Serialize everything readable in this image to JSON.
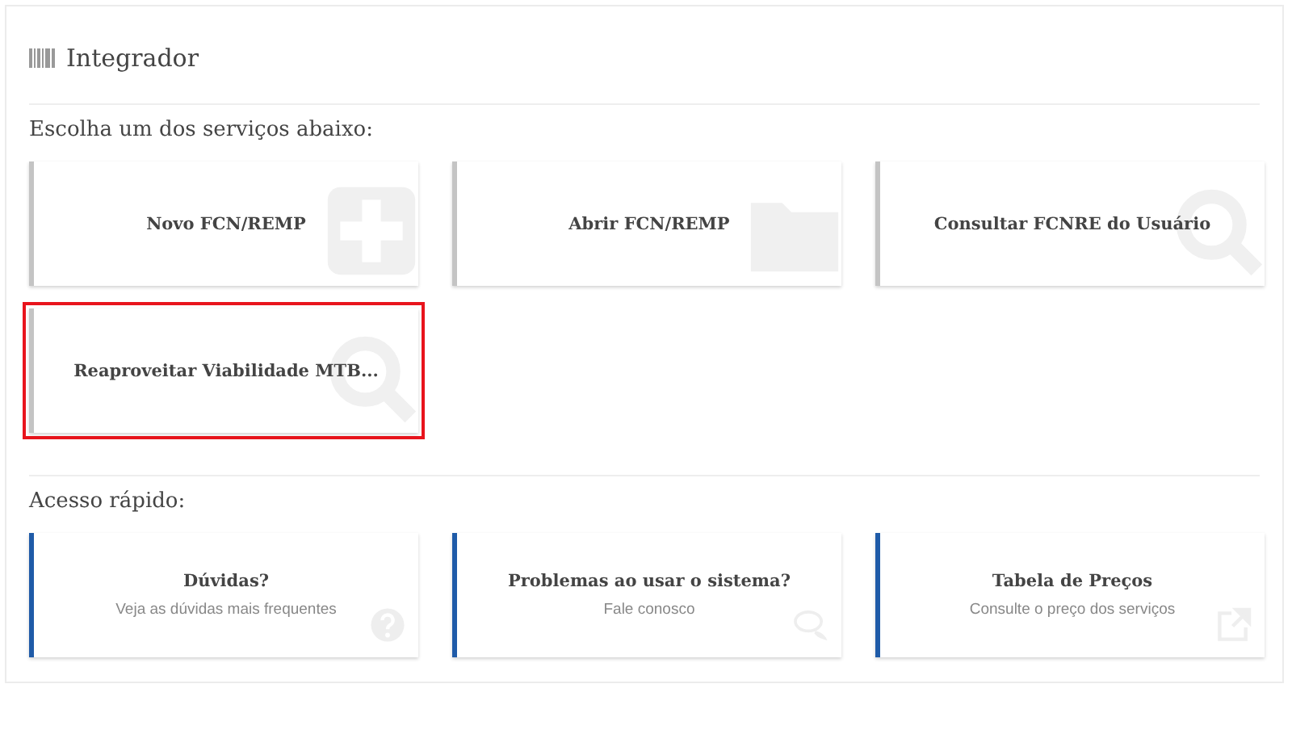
{
  "panel": {
    "title": "Integrador"
  },
  "services": {
    "label": "Escolha um dos serviços abaixo:",
    "items": [
      {
        "title": "Novo FCN/REMP",
        "kind": "plus",
        "highlighted": false
      },
      {
        "title": "Abrir FCN/REMP",
        "kind": "folder",
        "highlighted": false
      },
      {
        "title": "Consultar FCNRE do Usuário",
        "kind": "search",
        "highlighted": false
      },
      {
        "title": "Reaproveitar Viabilidade MTB...",
        "kind": "search",
        "highlighted": true
      }
    ]
  },
  "quick_access": {
    "label": "Acesso rápido:",
    "items": [
      {
        "title": "Dúvidas?",
        "subtitle": "Veja as dúvidas mais frequentes",
        "kind": "question"
      },
      {
        "title": "Problemas ao usar o sistema?",
        "subtitle": "Fale conosco",
        "kind": "chat"
      },
      {
        "title": "Tabela de Preços",
        "subtitle": "Consulte o preço dos serviços",
        "kind": "external"
      }
    ]
  }
}
